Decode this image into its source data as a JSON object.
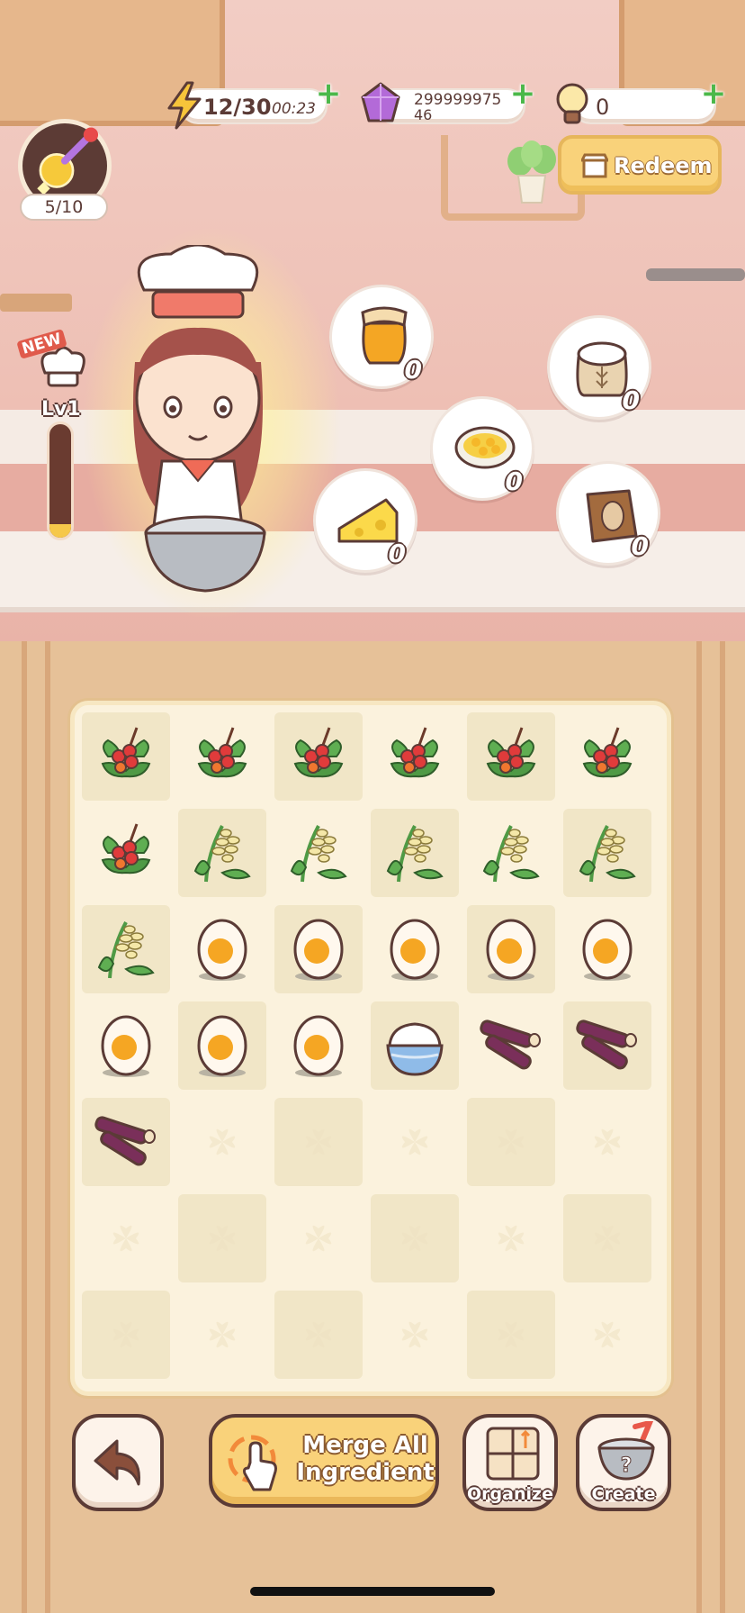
{
  "hud": {
    "energy": "12/30",
    "energy_timer": "00:23",
    "gems_line1": "299999975",
    "gems_line2": "46",
    "bulbs": "0",
    "redeem_label": "Redeem",
    "chef_count": "5/10"
  },
  "chef": {
    "new_label": "NEW",
    "level_label": "Lv1",
    "level_progress": 0.12
  },
  "ingredients": [
    {
      "name": "honey-jar",
      "qty": "0"
    },
    {
      "name": "flour-sack",
      "qty": "0"
    },
    {
      "name": "egg-yolk-bowl",
      "qty": "0"
    },
    {
      "name": "cheese",
      "qty": "0"
    },
    {
      "name": "coffee-bag",
      "qty": "0"
    }
  ],
  "board": {
    "cols": 6,
    "rows": 7,
    "items": [
      "coffee-cherry",
      "coffee-cherry",
      "coffee-cherry",
      "coffee-cherry",
      "coffee-cherry",
      "coffee-cherry",
      "coffee-cherry",
      "wheat",
      "wheat",
      "wheat",
      "wheat",
      "wheat",
      "wheat",
      "egg",
      "egg",
      "egg",
      "egg",
      "egg",
      "egg",
      "egg",
      "egg",
      "cream-bowl",
      "purple-sugarcane",
      "purple-sugarcane",
      "purple-sugarcane",
      "",
      "",
      "",
      "",
      "",
      "",
      "",
      "",
      "",
      "",
      "",
      "",
      "",
      "",
      "",
      "",
      ""
    ]
  },
  "buttons": {
    "merge_all": "Merge All Ingredient",
    "organize": "Organize",
    "create": "Create"
  },
  "colors": {
    "outline": "#5b3b36",
    "gold": "#f9d27a",
    "plus_green": "#4bb84a"
  }
}
